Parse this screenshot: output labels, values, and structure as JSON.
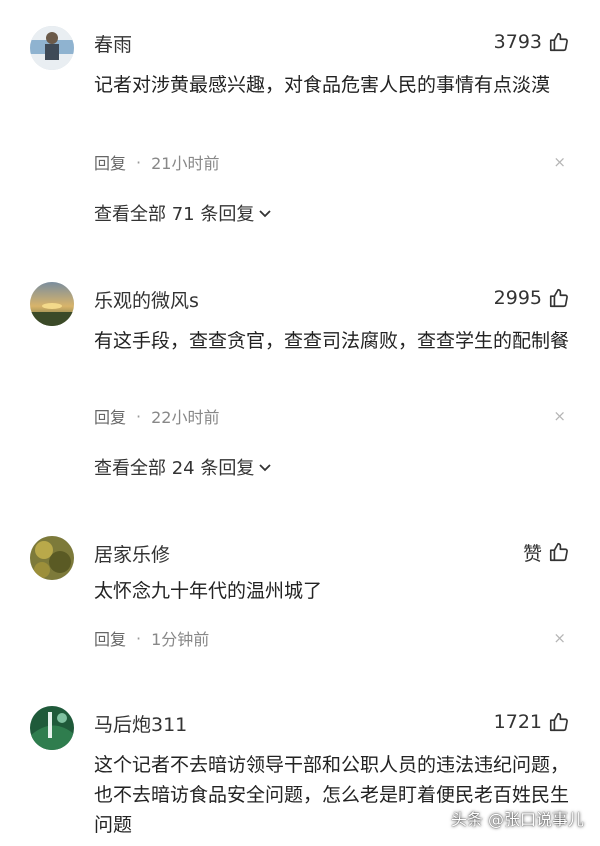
{
  "comments": [
    {
      "username": "春雨",
      "likes": "3793",
      "text": "记者对涉黄最感兴趣，对食品危害人民的事情有点淡漠",
      "reply_label": "回复",
      "separator": "·",
      "time": "21小时前",
      "close": "×",
      "view_replies": "查看全部 71 条回复"
    },
    {
      "username": "乐观的微风s",
      "likes": "2995",
      "text": "有这手段，查查贪官，查查司法腐败，查查学生的配制餐",
      "reply_label": "回复",
      "separator": "·",
      "time": "22小时前",
      "close": "×",
      "view_replies": "查看全部 24 条回复"
    },
    {
      "username": "居家乐修",
      "likes": "赞",
      "text": "太怀念九十年代的温州城了",
      "reply_label": "回复",
      "separator": "·",
      "time": "1分钟前",
      "close": "×"
    },
    {
      "username": "马后炮311",
      "likes": "1721",
      "text": "这个记者不去暗访领导干部和公职人员的违法违纪问题，也不去暗访食品安全问题，怎么老是盯着便民老百姓民生问题"
    }
  ],
  "watermark": "头条 @张口说事儿"
}
